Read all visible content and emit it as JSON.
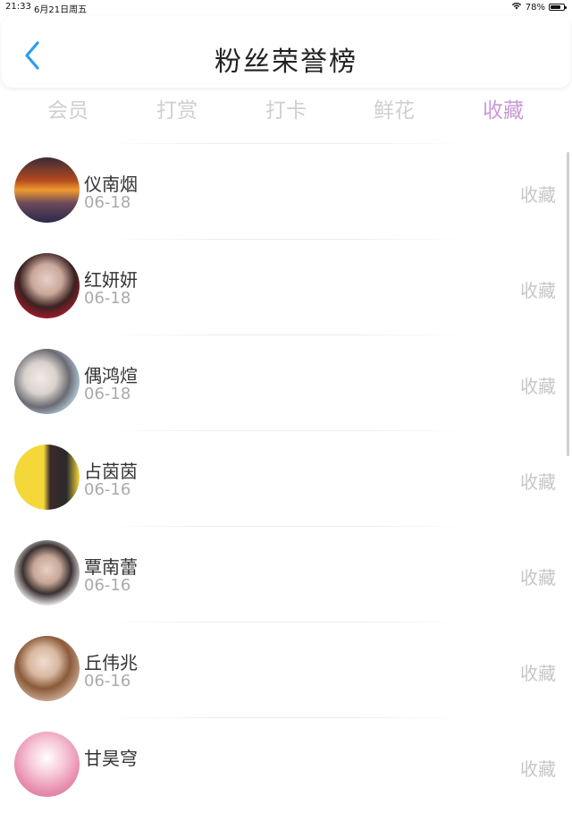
{
  "status_bar": {
    "time": "21:33",
    "date": "6月21日周五",
    "battery": "78%",
    "battery_level": 0.78
  },
  "header": {
    "title": "粉丝荣誉榜"
  },
  "tabs": [
    {
      "label": "会员"
    },
    {
      "label": "打赏"
    },
    {
      "label": "打卡"
    },
    {
      "label": "鲜花"
    },
    {
      "label": "收藏",
      "active": true
    }
  ],
  "colors": {
    "accent": "#c79ad6",
    "back": "#2f9bf0"
  },
  "fans": [
    {
      "name": "仪南烟",
      "date": "06-18",
      "action": "收藏"
    },
    {
      "name": "红妍妍",
      "date": "06-18",
      "action": "收藏"
    },
    {
      "name": "偶鸿煊",
      "date": "06-18",
      "action": "收藏"
    },
    {
      "name": "占茵茵",
      "date": "06-16",
      "action": "收藏"
    },
    {
      "name": "覃南蕾",
      "date": "06-16",
      "action": "收藏"
    },
    {
      "name": "丘伟兆",
      "date": "06-16",
      "action": "收藏"
    },
    {
      "name": "甘昊穹",
      "date": "",
      "action": "收藏"
    }
  ]
}
